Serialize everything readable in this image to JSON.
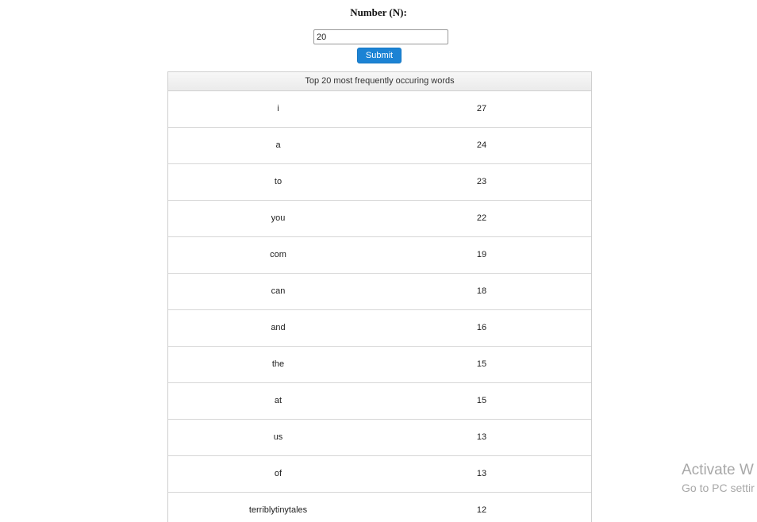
{
  "form": {
    "label": "Number (N):",
    "input_value": "20",
    "submit_label": "Submit"
  },
  "table": {
    "caption": "Top 20 most frequently occuring words",
    "rows": [
      {
        "word": "i",
        "count": "27"
      },
      {
        "word": "a",
        "count": "24"
      },
      {
        "word": "to",
        "count": "23"
      },
      {
        "word": "you",
        "count": "22"
      },
      {
        "word": "com",
        "count": "19"
      },
      {
        "word": "can",
        "count": "18"
      },
      {
        "word": "and",
        "count": "16"
      },
      {
        "word": "the",
        "count": "15"
      },
      {
        "word": "at",
        "count": "15"
      },
      {
        "word": "us",
        "count": "13"
      },
      {
        "word": "of",
        "count": "13"
      },
      {
        "word": "terriblytinytales",
        "count": "12"
      }
    ]
  },
  "watermark": {
    "title": "Activate W",
    "subtitle": "Go to PC settir"
  }
}
